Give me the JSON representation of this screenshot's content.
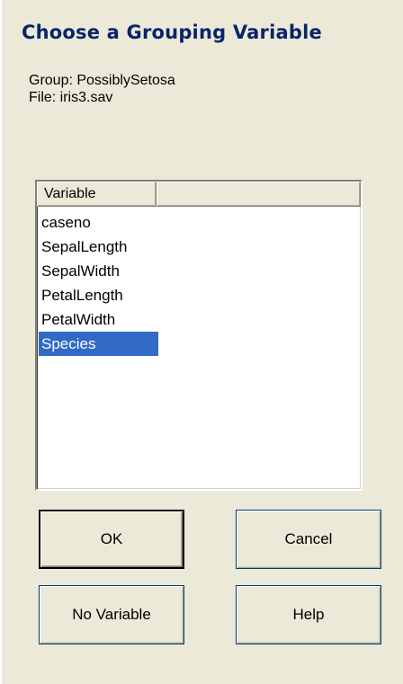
{
  "window": {
    "title": "Choose a Grouping Variable"
  },
  "info": {
    "group": "Group: PossiblySetosa",
    "file": "File: iris3.sav"
  },
  "list": {
    "columns": [
      "Variable",
      ""
    ],
    "items": [
      {
        "label": "caseno",
        "selected": false
      },
      {
        "label": "SepalLength",
        "selected": false
      },
      {
        "label": "SepalWidth",
        "selected": false
      },
      {
        "label": "PetalLength",
        "selected": false
      },
      {
        "label": "PetalWidth",
        "selected": false
      },
      {
        "label": "Species",
        "selected": true
      }
    ],
    "selection_color": "#316ac5"
  },
  "buttons": {
    "ok": "OK",
    "cancel": "Cancel",
    "no_variable": "No Variable",
    "help": "Help"
  }
}
